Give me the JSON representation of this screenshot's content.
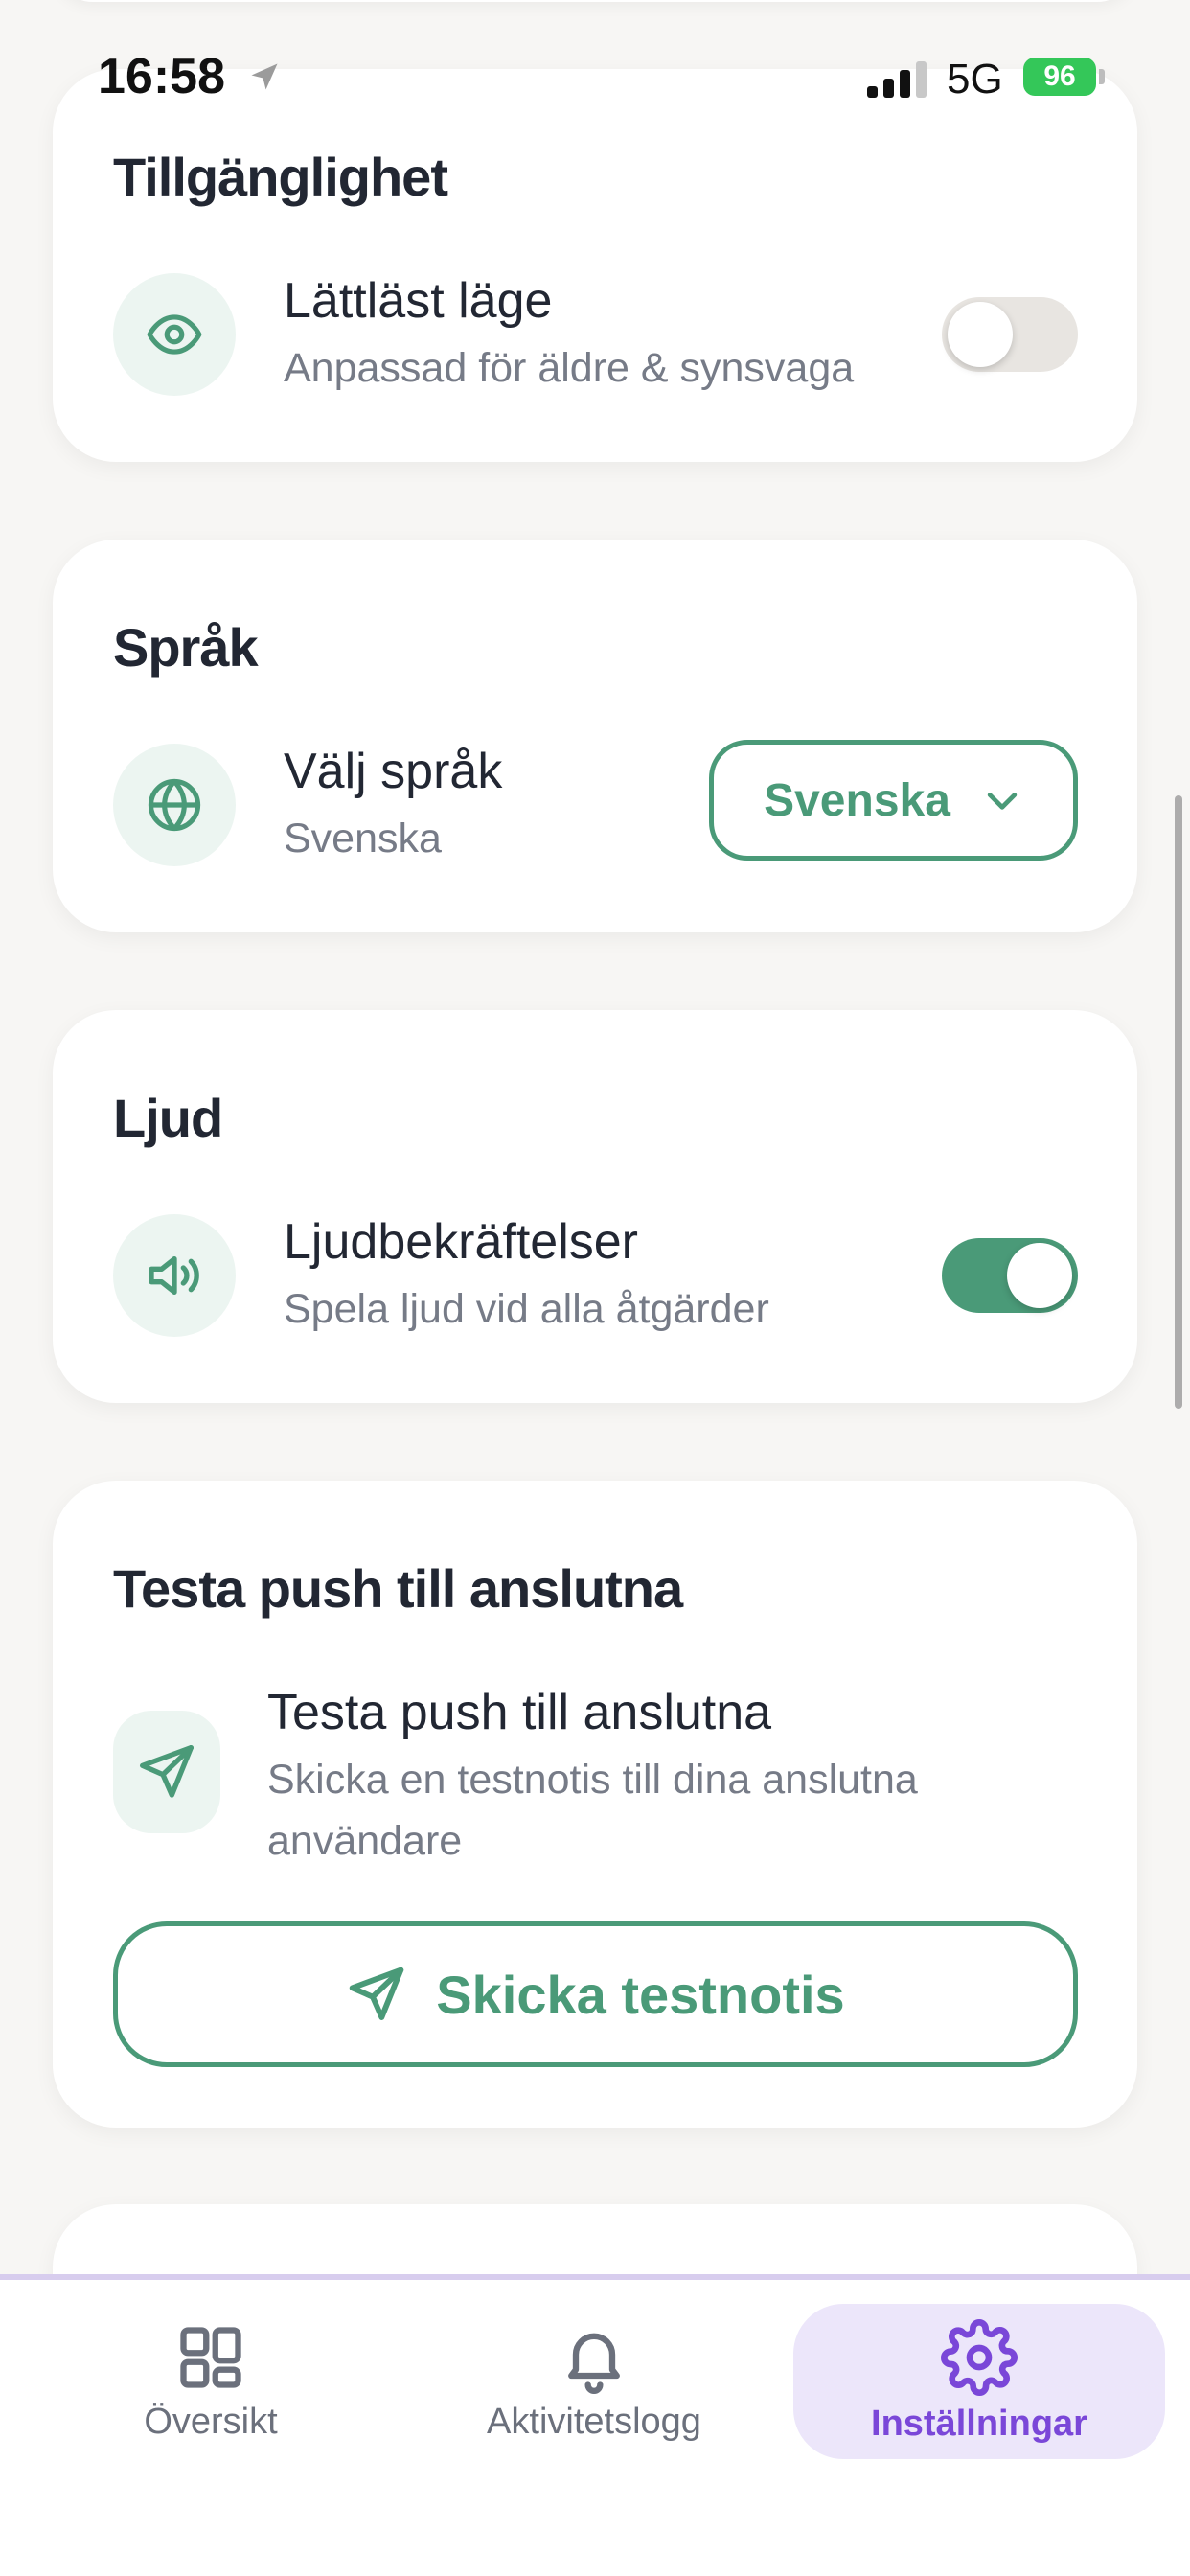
{
  "status_bar": {
    "time": "16:58",
    "network": "5G",
    "battery": "96"
  },
  "accessibility": {
    "title": "Tillgänglighet",
    "easy_read": {
      "label": "Lättläst läge",
      "description": "Anpassad för äldre & synsvaga",
      "enabled": false
    }
  },
  "language": {
    "title": "Språk",
    "select": {
      "label": "Välj språk",
      "current": "Svenska",
      "selected_option": "Svenska"
    }
  },
  "sound": {
    "title": "Ljud",
    "confirmations": {
      "label": "Ljudbekräftelser",
      "description": "Spela ljud vid alla åtgärder",
      "enabled": true
    }
  },
  "push_test": {
    "title": "Testa push till anslutna",
    "row_label": "Testa push till anslutna",
    "description_line1": "Skicka en testnotis till dina anslutna",
    "description_line2": "användare",
    "button_label": "Skicka testnotis"
  },
  "nav": {
    "items": [
      {
        "label": "Översikt",
        "icon": "grid-icon",
        "active": false
      },
      {
        "label": "Aktivitetslogg",
        "icon": "bell-icon",
        "active": false
      },
      {
        "label": "Inställningar",
        "icon": "gear-icon",
        "active": true
      }
    ]
  },
  "colors": {
    "accent": "#4a9a78",
    "nav_active": "#7a47d8",
    "nav_active_bg": "#ece6fa"
  }
}
